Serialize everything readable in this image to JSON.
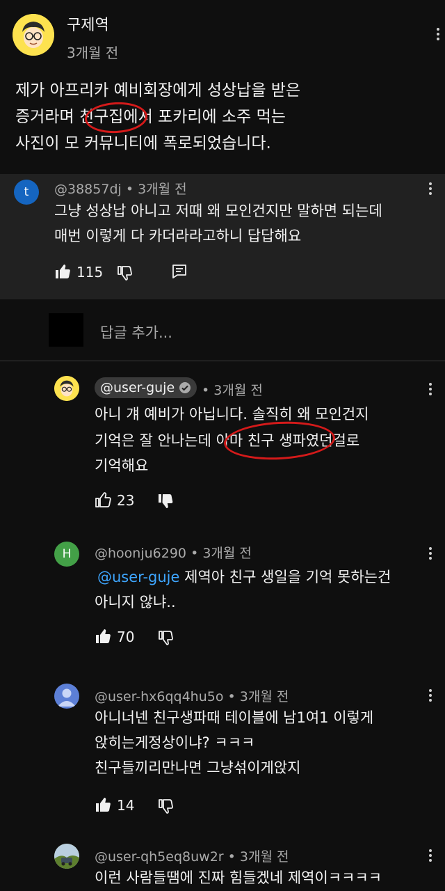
{
  "op": {
    "author": "구제역",
    "time": "3개월 전",
    "lines": [
      "제가 아프리카 예비회장에게 성상납을 받은",
      "증거라며 친구집에서 포카리에 소주 먹는",
      "사진이 모 커뮤니티에 폭로되었습니다."
    ],
    "highlight": "친구집"
  },
  "comment1": {
    "avatar_letter": "t",
    "avatar_color": "#1565c0",
    "author": "@38857dj",
    "sep": "•",
    "time": "3개월 전",
    "lines": [
      "그냥 성상납 아니고 저때 왜 모인건지만 말하면 되는데",
      "매번 이렇게 다 카더라라고하니 답답해요"
    ],
    "likes": "115"
  },
  "reply_input": {
    "placeholder": "답글 추가..."
  },
  "replies": [
    {
      "author": "@user-guje",
      "verified": true,
      "sep": "•",
      "time": "3개월 전",
      "lines": [
        "아니 걔 예비가 아닙니다. 솔직히 왜 모인건지",
        "기억은 잘 안나는데 아마 친구 생파였던걸로",
        "기억해요"
      ],
      "highlight": "아마 친구 생파",
      "likes": "23"
    },
    {
      "avatar_letter": "H",
      "avatar_color": "#43a047",
      "author": "@hoonju6290",
      "sep": "•",
      "time": "3개월 전",
      "mention": "@user-guje",
      "lines": [
        "제역아 친구 생일을 기억 못하는건",
        "아니지 않냐.."
      ],
      "likes": "70"
    },
    {
      "avatar_color": "#5c7fd6",
      "author": "@user-hx6qq4hu5o",
      "sep": "•",
      "time": "3개월 전",
      "lines": [
        "아니너넨 친구생파때 테이블에 남1여1 이렇게",
        "앉히는게정상이냐? ㅋㅋㅋ",
        "친구들끼리만나면 그냥섞이게앉지"
      ],
      "likes": "14"
    },
    {
      "author": "@user-qh5eq8uw2r",
      "sep": "•",
      "time": "3개월 전",
      "lines": [
        "이런 사람들땜에 진짜 힘들겠네 제역이ㅋㅋㅋㅋ"
      ]
    }
  ],
  "colors": {
    "background": "#0f0f0f",
    "highlight_panel": "#212121",
    "mention": "#3ea6ff",
    "annotation": "#d41a1a"
  }
}
